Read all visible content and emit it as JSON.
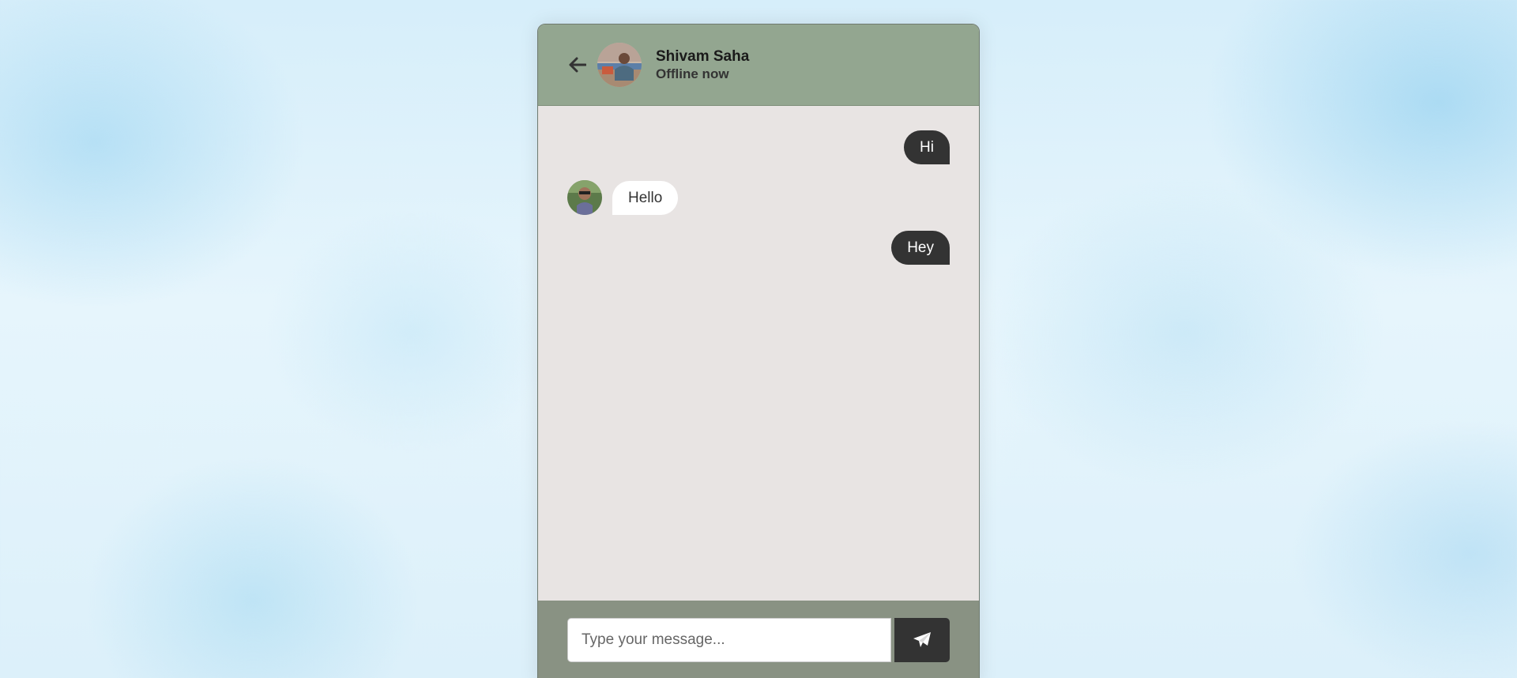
{
  "contact": {
    "name": "Shivam Saha",
    "status": "Offline now"
  },
  "header": {
    "back_icon": "arrow-left-icon"
  },
  "messages": [
    {
      "direction": "outgoing",
      "text": "Hi"
    },
    {
      "direction": "incoming",
      "text": "Hello"
    },
    {
      "direction": "outgoing",
      "text": "Hey"
    }
  ],
  "composer": {
    "placeholder": "Type your message...",
    "value": "",
    "send_icon": "paper-plane-icon"
  },
  "colors": {
    "header_bg": "#93a690",
    "footer_bg": "#899283",
    "chat_bg": "#e8e4e3",
    "outgoing_bubble": "#333333",
    "incoming_bubble": "#ffffff"
  }
}
